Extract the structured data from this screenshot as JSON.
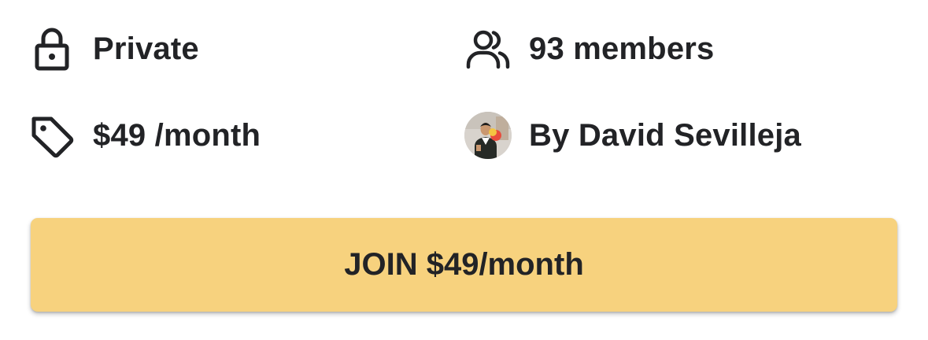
{
  "group_info": {
    "privacy": {
      "label": "Private",
      "icon": "lock-icon"
    },
    "members": {
      "label": "93 members",
      "icon": "users-icon"
    },
    "price": {
      "label": "$49 /month",
      "icon": "price-tag-icon"
    },
    "owner": {
      "label": "By David Sevilleja",
      "icon": "avatar"
    }
  },
  "join_button": {
    "label": "JOIN $49/month",
    "background": "#f7d27e"
  },
  "colors": {
    "text": "#222326",
    "accent": "#f7d27e"
  }
}
